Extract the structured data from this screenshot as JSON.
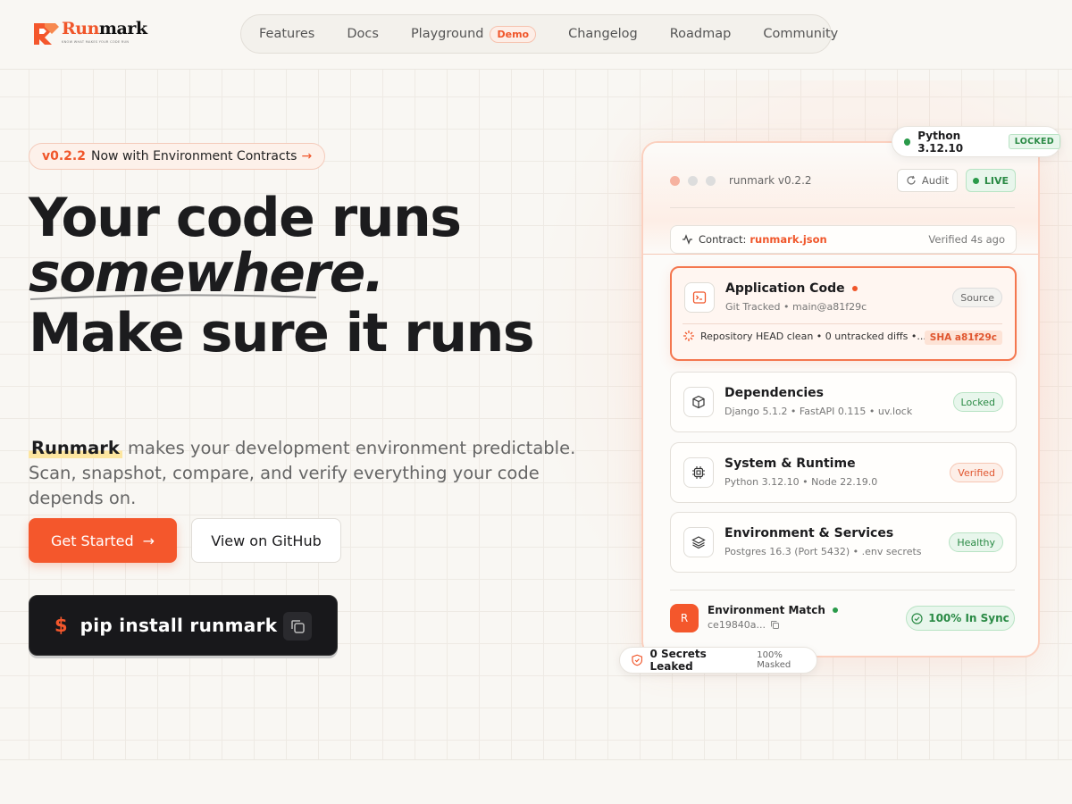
{
  "brand": {
    "name_part1": "Run",
    "name_part2": "mark",
    "tagline": "Know what makes your code run",
    "accent": "#f0562a"
  },
  "nav": {
    "items": [
      {
        "label": "Features"
      },
      {
        "label": "Docs"
      },
      {
        "label": "Playground",
        "badge": "Demo"
      },
      {
        "label": "Changelog"
      },
      {
        "label": "Roadmap"
      },
      {
        "label": "Community"
      }
    ]
  },
  "hero": {
    "version": "v0.2.2",
    "announcement": "Now with Environment Contracts",
    "headline_1": "Your code runs",
    "headline_2": "somewhere.",
    "headline_3": "Make sure it runs",
    "description_brand": "Runmark",
    "description_rest": " makes your development environment predictable. Scan, snapshot, compare, and verify everything your code depends on.",
    "primary_cta": "Get Started",
    "secondary_cta": "View on GitHub",
    "install_prompt": "$",
    "install_command": "pip install runmark"
  },
  "card": {
    "title": "runmark v0.2.2",
    "audit_label": "Audit",
    "live_label": "LIVE",
    "contract_label": "Contract:",
    "contract_file": "runmark.json",
    "contract_verified": "Verified 4s ago",
    "items": [
      {
        "title": "Application Code",
        "subtitle": "Git Tracked • main@a81f29c",
        "badge": "Source",
        "icon": "terminal-icon"
      },
      {
        "title": "Dependencies",
        "subtitle": "Django 5.1.2 • FastAPI 0.115 • uv.lock",
        "badge": "Locked",
        "icon": "package-icon"
      },
      {
        "title": "System & Runtime",
        "subtitle": "Python 3.12.10 • Node 22.19.0",
        "badge": "Verified",
        "icon": "cpu-icon"
      },
      {
        "title": "Environment & Services",
        "subtitle": "Postgres 16.3 (Port 5432) • .env secrets",
        "badge": "Healthy",
        "icon": "layers-icon"
      }
    ],
    "active_detail": "Repository HEAD clean • 0 untracked diffs •...",
    "active_sha": "SHA a81f29c",
    "match_avatar": "R",
    "match_title": "Environment Match",
    "match_hash": "ce19840a...",
    "sync_label": "100% In Sync"
  },
  "floats": {
    "python_label": "Python 3.12.10",
    "python_tag": "LOCKED",
    "secrets_label": "0 Secrets Leaked",
    "secrets_masked": "100% Masked"
  }
}
